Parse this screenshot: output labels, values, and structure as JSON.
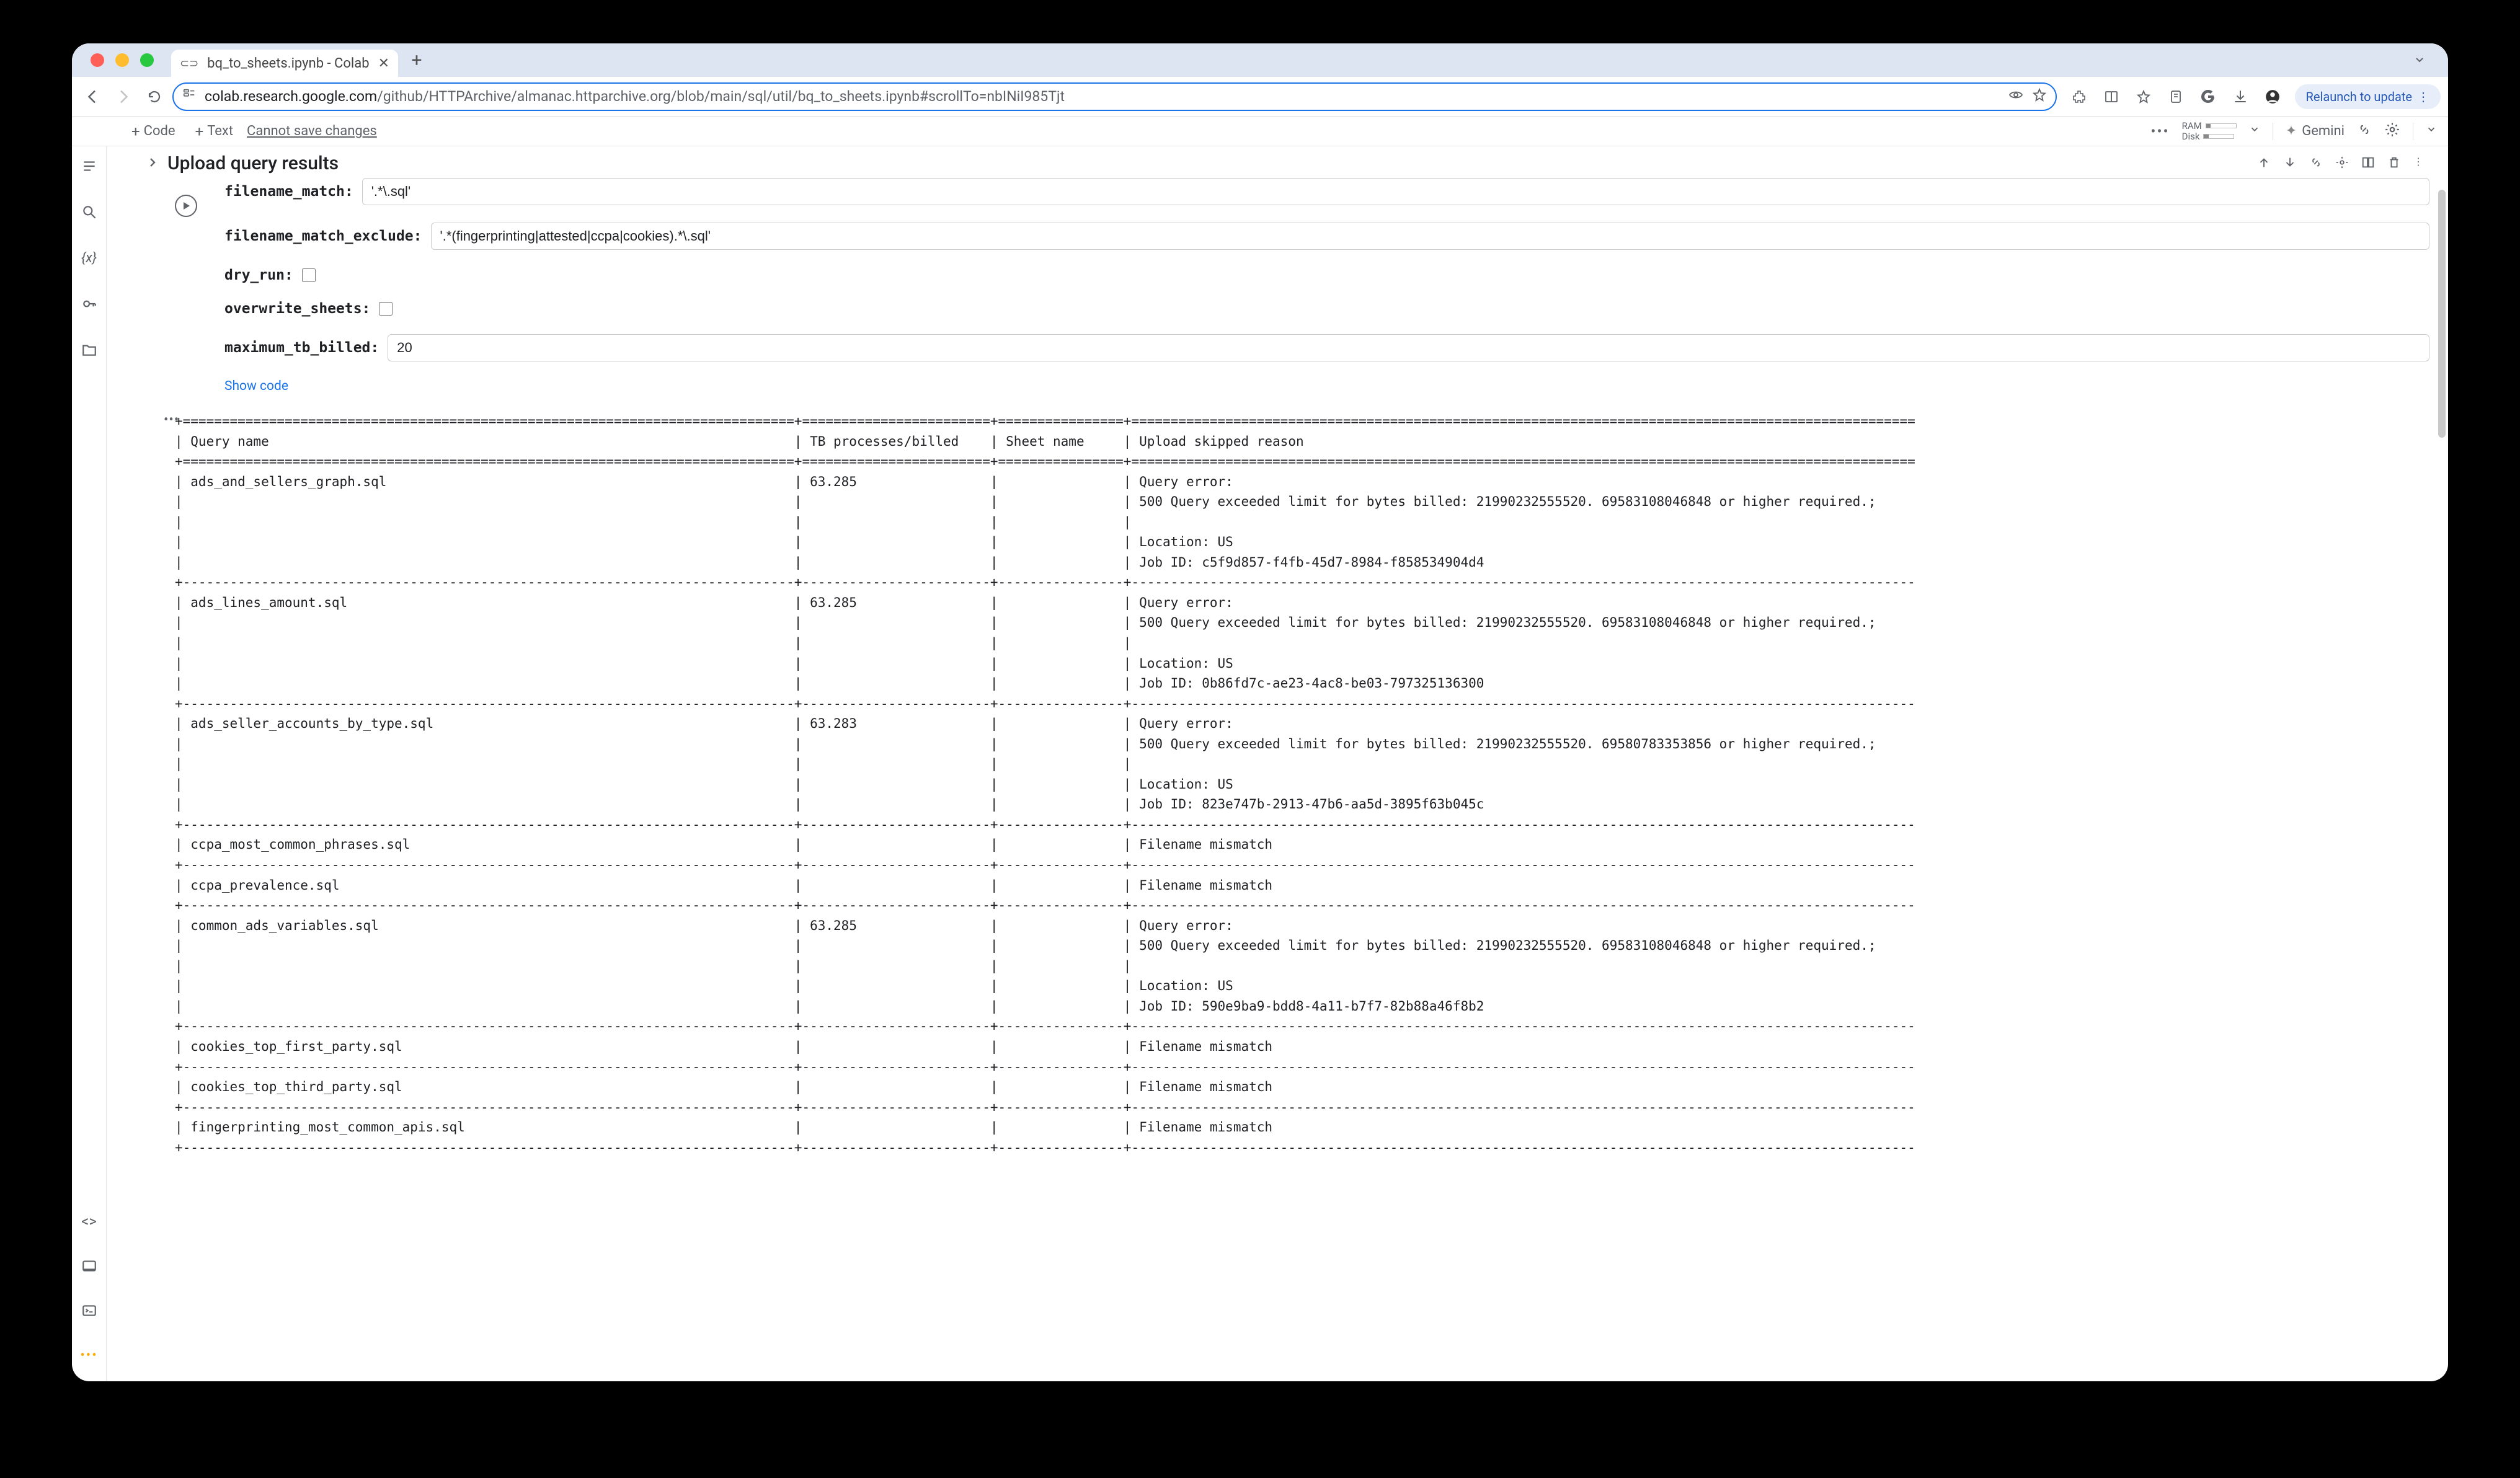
{
  "browser": {
    "tab_title": "bq_to_sheets.ipynb - Colab",
    "url_domain": "colab.research.google.com",
    "url_path": "/github/HTTPArchive/almanac.httparchive.org/blob/main/sql/util/bq_to_sheets.ipynb#scrollTo=nbINiI985Tjt",
    "relaunch": "Relaunch to update"
  },
  "colab": {
    "code": "Code",
    "text": "Text",
    "cannot_save": "Cannot save changes",
    "ram": "RAM",
    "disk": "Disk",
    "gemini": "Gemini"
  },
  "cell": {
    "title": "Upload query results",
    "filename_match_label": "filename_match:",
    "filename_match_value": "'.*\\.sql'",
    "filename_match_exclude_label": "filename_match_exclude:",
    "filename_match_exclude_value": "'.*(fingerprinting|attested|ccpa|cookies).*\\.sql'",
    "dry_run_label": "dry_run:",
    "overwrite_label": "overwrite_sheets:",
    "max_tb_label": "maximum_tb_billed:",
    "max_tb_value": "20",
    "show_code": "Show code"
  },
  "table": {
    "hdr_query": "Query name",
    "hdr_tb": "TB processes/billed",
    "hdr_sheet": "Sheet name",
    "hdr_reason": "Upload skipped reason",
    "rows": [
      {
        "name": "ads_and_sellers_graph.sql",
        "tb": "63.285",
        "sheet": "",
        "reason": "Query error:\n500 Query exceeded limit for bytes billed: 21990232555520. 69583108046848 or higher required.;\n\nLocation: US\nJob ID: c5f9d857-f4fb-45d7-8984-f858534904d4"
      },
      {
        "name": "ads_lines_amount.sql",
        "tb": "63.285",
        "sheet": "",
        "reason": "Query error:\n500 Query exceeded limit for bytes billed: 21990232555520. 69583108046848 or higher required.;\n\nLocation: US\nJob ID: 0b86fd7c-ae23-4ac8-be03-797325136300"
      },
      {
        "name": "ads_seller_accounts_by_type.sql",
        "tb": "63.283",
        "sheet": "",
        "reason": "Query error:\n500 Query exceeded limit for bytes billed: 21990232555520. 69580783353856 or higher required.;\n\nLocation: US\nJob ID: 823e747b-2913-47b6-aa5d-3895f63b045c"
      },
      {
        "name": "ccpa_most_common_phrases.sql",
        "tb": "",
        "sheet": "",
        "reason": "Filename mismatch"
      },
      {
        "name": "ccpa_prevalence.sql",
        "tb": "",
        "sheet": "",
        "reason": "Filename mismatch"
      },
      {
        "name": "common_ads_variables.sql",
        "tb": "63.285",
        "sheet": "",
        "reason": "Query error:\n500 Query exceeded limit for bytes billed: 21990232555520. 69583108046848 or higher required.;\n\nLocation: US\nJob ID: 590e9ba9-bdd8-4a11-b7f7-82b88a46f8b2"
      },
      {
        "name": "cookies_top_first_party.sql",
        "tb": "",
        "sheet": "",
        "reason": "Filename mismatch"
      },
      {
        "name": "cookies_top_third_party.sql",
        "tb": "",
        "sheet": "",
        "reason": "Filename mismatch"
      },
      {
        "name": "fingerprinting_most_common_apis.sql",
        "tb": "",
        "sheet": "",
        "reason": "Filename mismatch"
      }
    ]
  }
}
